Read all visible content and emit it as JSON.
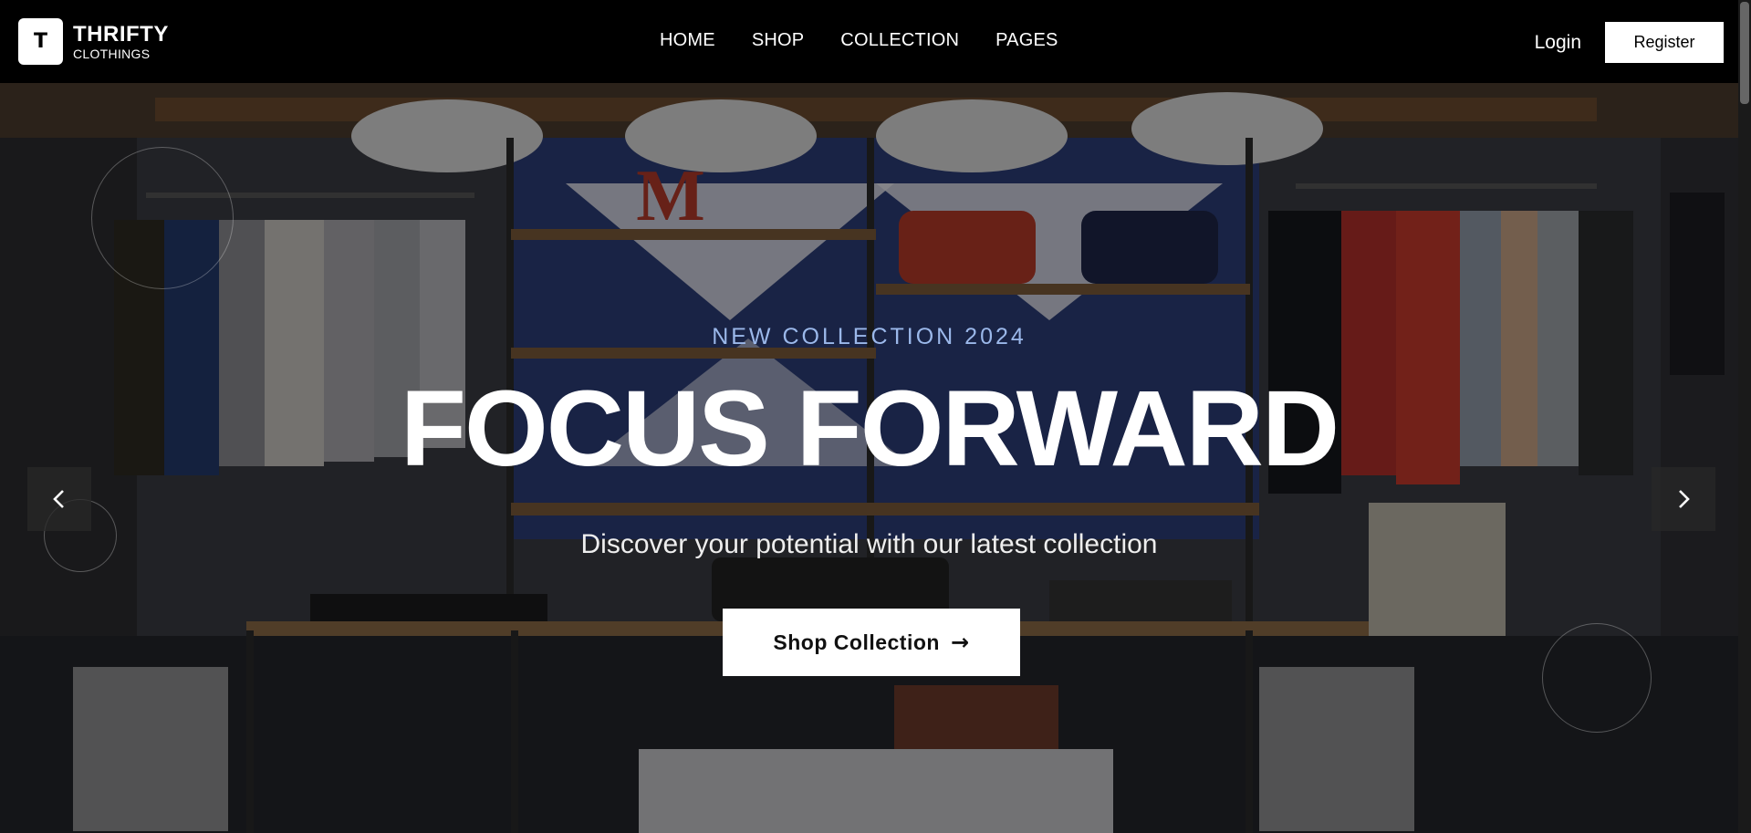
{
  "brand": {
    "logo_letter": "T",
    "name": "THRIFTY",
    "tagline": "CLOTHINGS"
  },
  "nav": {
    "items": [
      {
        "label": "HOME"
      },
      {
        "label": "SHOP"
      },
      {
        "label": "COLLECTION"
      },
      {
        "label": "PAGES"
      }
    ]
  },
  "auth": {
    "login_label": "Login",
    "register_label": "Register"
  },
  "hero": {
    "eyebrow": "NEW COLLECTION 2024",
    "headline": "FOCUS FORWARD",
    "subheadline": "Discover your potential with our latest collection",
    "cta_label": "Shop Collection",
    "cta_icon": "arrow-right-icon",
    "prev_icon": "chevron-left-icon",
    "next_icon": "chevron-right-icon",
    "background": "clothing store interior photo"
  },
  "colors": {
    "accent_eyebrow": "#9bb8ea",
    "header_bg": "#000000",
    "button_bg": "#ffffff"
  }
}
